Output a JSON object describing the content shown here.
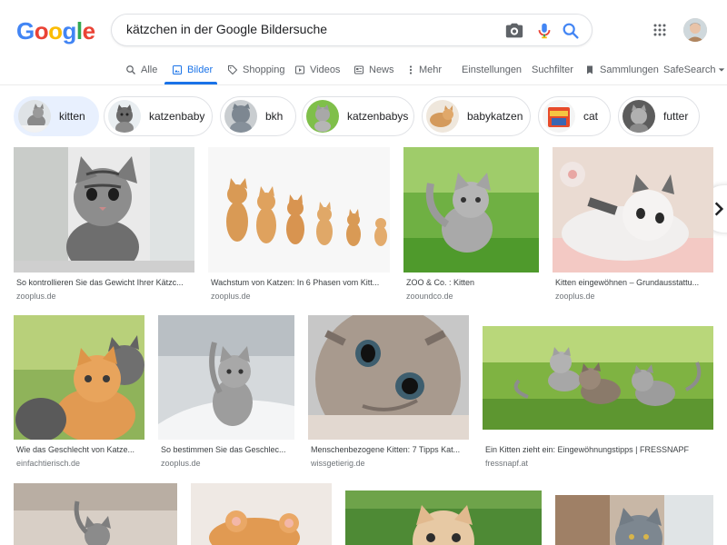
{
  "search": {
    "query": "kätzchen in der Google Bildersuche"
  },
  "logo": [
    "G",
    "o",
    "o",
    "g",
    "l",
    "e"
  ],
  "colors": {
    "accent": "#1a73e8",
    "logo_blue": "#4285f4",
    "logo_red": "#ea4335",
    "logo_yellow": "#fbbc05",
    "logo_green": "#34a853"
  },
  "tabs": [
    {
      "label": "Alle",
      "icon": "search-icon"
    },
    {
      "label": "Bilder",
      "icon": "image-icon",
      "active": true
    },
    {
      "label": "Shopping",
      "icon": "tag-icon"
    },
    {
      "label": "Videos",
      "icon": "play-icon"
    },
    {
      "label": "News",
      "icon": "newspaper-icon"
    },
    {
      "label": "Mehr",
      "icon": "more-vert-icon"
    }
  ],
  "tools": {
    "settings": "Einstellungen",
    "filter": "Suchfilter",
    "collections": "Sammlungen",
    "safesearch": "SafeSearch"
  },
  "chips": [
    {
      "label": "kitten"
    },
    {
      "label": "katzenbaby"
    },
    {
      "label": "bkh"
    },
    {
      "label": "katzenbabys"
    },
    {
      "label": "babykatzen"
    },
    {
      "label": "cat"
    },
    {
      "label": "futter"
    }
  ],
  "results": [
    {
      "title": "So kontrollieren Sie das Gewicht Ihrer Kätzc...",
      "source": "zooplus.de"
    },
    {
      "title": "Wachstum von Katzen: In 6 Phasen vom Kitt...",
      "source": "zooplus.de"
    },
    {
      "title": "ZOO & Co. : Kitten",
      "source": "zooundco.de"
    },
    {
      "title": "Kitten eingewöhnen – Grundausstattu...",
      "source": "zooplus.de"
    },
    {
      "title": "Wie das Geschlecht von Katze...",
      "source": "einfachtierisch.de"
    },
    {
      "title": "So bestimmen Sie das Geschlec...",
      "source": "zooplus.de"
    },
    {
      "title": "Menschenbezogene Kitten: 7 Tipps Kat...",
      "source": "wissgetierig.de"
    },
    {
      "title": "Ein Kitten zieht ein: Eingewöhnungstipps | FRESSNAPF",
      "source": "fressnapf.at"
    }
  ]
}
